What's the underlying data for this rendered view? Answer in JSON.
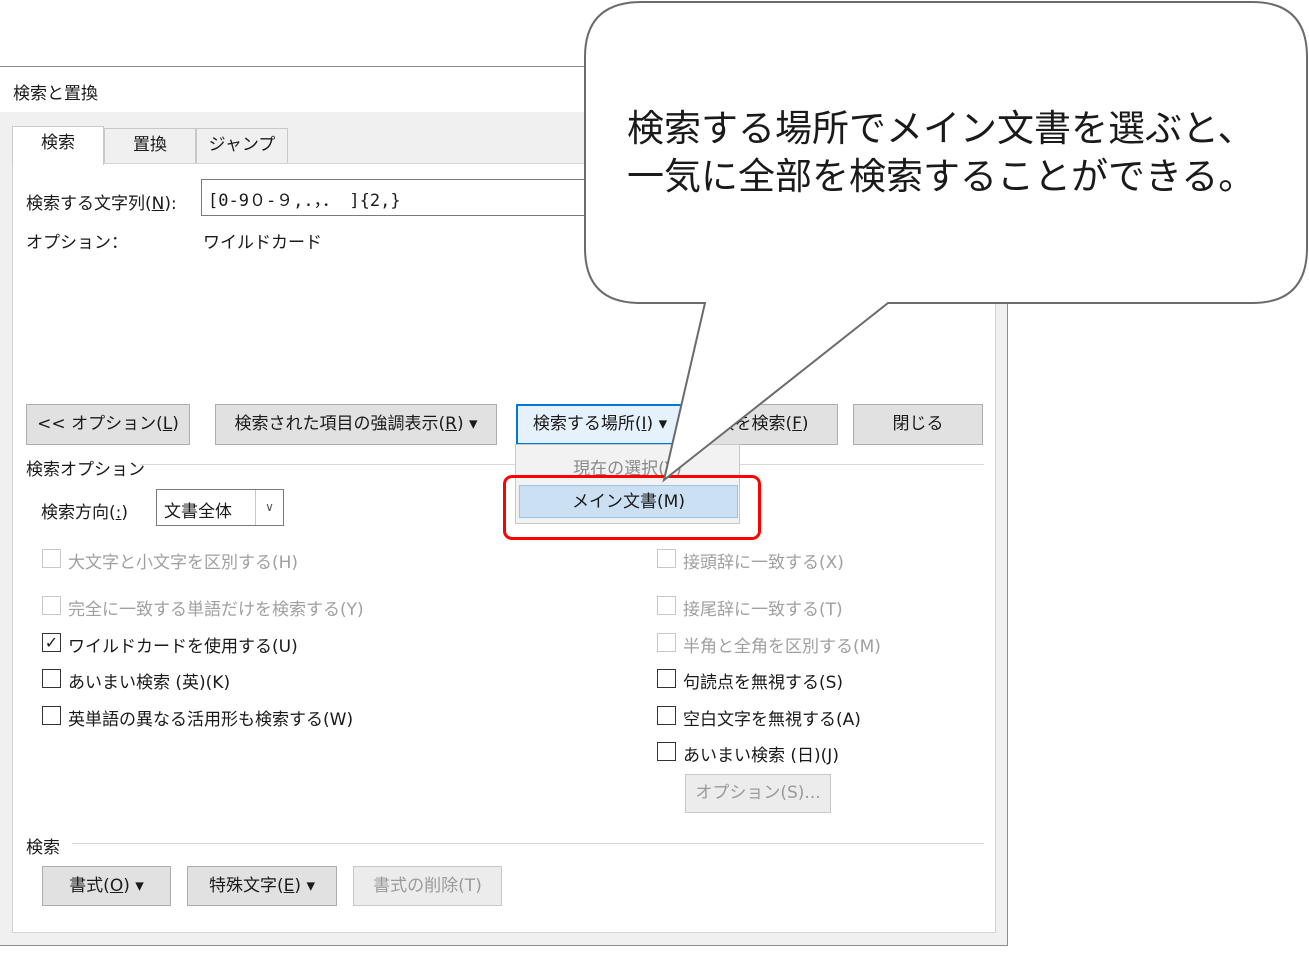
{
  "dialog": {
    "title": "検索と置換",
    "tabs": [
      {
        "label": "検索",
        "active": true
      },
      {
        "label": "置換",
        "active": false
      },
      {
        "label": "ジャンプ",
        "active": false
      }
    ]
  },
  "find": {
    "label_text": "検索する文字列(",
    "label_key": "N",
    "label_end": "):",
    "value": "[0-9０-９,.，．  ]{2,}",
    "options_label": "オプション：",
    "options_value": "ワイルドカード"
  },
  "buttons": {
    "options": {
      "text": "<< オプション(",
      "key": "L",
      "end": ")"
    },
    "highlight": {
      "text": "検索された項目の強調表示(",
      "key": "R",
      "end": ") ▾"
    },
    "find_in": {
      "text": "検索する場所(",
      "key": "I",
      "end": ") ▾"
    },
    "find_next": {
      "text": "次を検索(",
      "key": "F",
      "end": ")"
    },
    "close": "閉じる"
  },
  "dropdown": {
    "current_selection": "現在の選択(Y)",
    "main_document": "メイン文書(M)"
  },
  "search_options": {
    "title": "検索オプション",
    "direction_label": "検索方向(",
    "direction_key": ":",
    "direction_end": ")",
    "direction_value": "文書全体",
    "left": [
      {
        "label": "大文字と小文字を区別する(H)",
        "checked": false,
        "disabled": true
      },
      {
        "label": "完全に一致する単語だけを検索する(Y)",
        "checked": false,
        "disabled": true
      },
      {
        "label": "ワイルドカードを使用する(U)",
        "checked": true,
        "disabled": false
      },
      {
        "label": "あいまい検索 (英)(K)",
        "checked": false,
        "disabled": false
      },
      {
        "label": "英単語の異なる活用形も検索する(W)",
        "checked": false,
        "disabled": false
      }
    ],
    "right": [
      {
        "label": "接頭辞に一致する(X)",
        "checked": false,
        "disabled": true
      },
      {
        "label": "接尾辞に一致する(T)",
        "checked": false,
        "disabled": true
      },
      {
        "label": "半角と全角を区別する(M)",
        "checked": false,
        "disabled": true
      },
      {
        "label": "句読点を無視する(S)",
        "checked": false,
        "disabled": false
      },
      {
        "label": "空白文字を無視する(A)",
        "checked": false,
        "disabled": false
      },
      {
        "label": "あいまい検索 (日)(J)",
        "checked": false,
        "disabled": false
      }
    ],
    "fuzzy_options_button": "オプション(S)..."
  },
  "search_section": {
    "title": "検索",
    "format": {
      "text": "書式(",
      "key": "O",
      "end": ") ▾"
    },
    "special": {
      "text": "特殊文字(",
      "key": "E",
      "end": ") ▾"
    },
    "no_format": "書式の削除(T)"
  },
  "callout": {
    "line1": "検索する場所でメイン文書を選ぶと、",
    "line2": "一気に全部を検索することができる。"
  },
  "colors": {
    "accent": "#0078d7",
    "highlight_frame": "#ff0000"
  }
}
